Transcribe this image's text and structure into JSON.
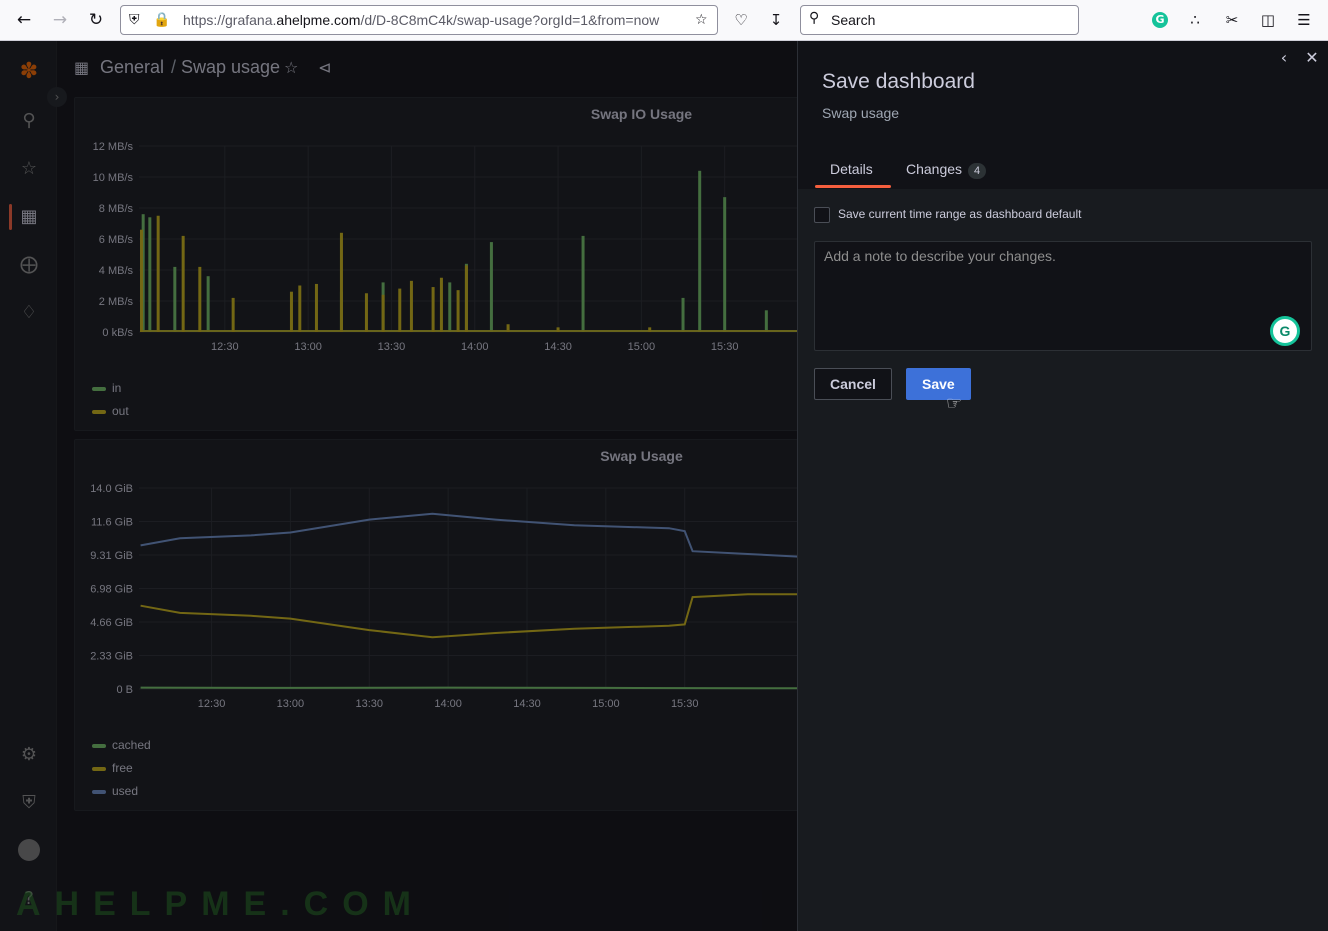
{
  "browser": {
    "url_prefix": "https://grafana.",
    "url_domain": "ahelpme.com",
    "url_rest": "/d/D-8C8mC4k/swap-usage?orgId=1&from=now",
    "search_placeholder": "Search"
  },
  "breadcrumb": {
    "folder": "General",
    "separator": "/",
    "dashboard": "Swap usage"
  },
  "panels": {
    "io": {
      "title": "Swap IO Usage",
      "legend": [
        {
          "name": "in",
          "color": "#73bf69"
        },
        {
          "name": "out",
          "color": "#c8b21b"
        }
      ]
    },
    "usage": {
      "title": "Swap Usage",
      "legend": [
        {
          "name": "cached",
          "color": "#73bf69"
        },
        {
          "name": "free",
          "color": "#c8b21b"
        },
        {
          "name": "used",
          "color": "#6e8ec8"
        }
      ]
    }
  },
  "chart_data": [
    {
      "type": "bar",
      "title": "Swap IO Usage",
      "y_ticks": [
        "0 kB/s",
        "2 MB/s",
        "4 MB/s",
        "6 MB/s",
        "8 MB/s",
        "10 MB/s",
        "12 MB/s"
      ],
      "ylim_mbps": [
        0,
        12
      ],
      "x_ticks": [
        "12:30",
        "13:00",
        "13:30",
        "14:00",
        "14:30",
        "15:00",
        "15:30"
      ],
      "series": [
        {
          "name": "in",
          "color": "#73bf69",
          "peaks": [
            [
              12.01,
              7.6
            ],
            [
              12.05,
              7.4
            ],
            [
              12.2,
              4.2
            ],
            [
              12.4,
              3.6
            ],
            [
              13.2,
              2.6
            ],
            [
              13.45,
              3.2
            ],
            [
              13.85,
              3.2
            ],
            [
              13.95,
              4.4
            ],
            [
              14.1,
              5.8
            ],
            [
              14.65,
              6.2
            ],
            [
              15.25,
              2.2
            ],
            [
              15.35,
              10.4
            ],
            [
              15.5,
              8.7
            ],
            [
              15.75,
              1.4
            ],
            [
              15.95,
              0.4
            ]
          ]
        },
        {
          "name": "out",
          "color": "#c8b21b",
          "peaks": [
            [
              12.0,
              6.6
            ],
            [
              12.1,
              7.5
            ],
            [
              12.25,
              6.2
            ],
            [
              12.35,
              4.2
            ],
            [
              12.55,
              2.2
            ],
            [
              12.9,
              2.6
            ],
            [
              12.95,
              3.0
            ],
            [
              13.05,
              3.1
            ],
            [
              13.2,
              6.4
            ],
            [
              13.35,
              2.5
            ],
            [
              13.45,
              2.4
            ],
            [
              13.55,
              2.8
            ],
            [
              13.62,
              3.3
            ],
            [
              13.75,
              2.9
            ],
            [
              13.8,
              3.5
            ],
            [
              13.9,
              2.7
            ],
            [
              13.95,
              4.3
            ],
            [
              14.2,
              0.5
            ],
            [
              14.5,
              0.3
            ],
            [
              15.05,
              0.3
            ]
          ]
        }
      ]
    },
    {
      "type": "line",
      "title": "Swap Usage",
      "y_ticks": [
        "0 B",
        "2.33 GiB",
        "4.66 GiB",
        "6.98 GiB",
        "9.31 GiB",
        "11.6 GiB",
        "14.0 GiB"
      ],
      "ylim_gib": [
        0,
        14
      ],
      "x_ticks": [
        "12:30",
        "13:00",
        "13:30",
        "14:00",
        "14:30",
        "15:00",
        "15:30"
      ],
      "series": [
        {
          "name": "used",
          "color": "#6e8ec8",
          "points": [
            [
              12.05,
              10.0
            ],
            [
              12.3,
              10.5
            ],
            [
              12.75,
              10.7
            ],
            [
              13.0,
              10.9
            ],
            [
              13.5,
              11.8
            ],
            [
              13.9,
              12.2
            ],
            [
              14.3,
              11.8
            ],
            [
              14.8,
              11.4
            ],
            [
              15.4,
              11.2
            ],
            [
              15.5,
              11.0
            ],
            [
              15.55,
              9.6
            ],
            [
              15.9,
              9.4
            ],
            [
              16.25,
              9.2
            ]
          ]
        },
        {
          "name": "free",
          "color": "#c8b21b",
          "points": [
            [
              12.05,
              5.8
            ],
            [
              12.3,
              5.3
            ],
            [
              12.75,
              5.1
            ],
            [
              13.0,
              4.9
            ],
            [
              13.5,
              4.1
            ],
            [
              13.9,
              3.6
            ],
            [
              14.3,
              3.9
            ],
            [
              14.8,
              4.2
            ],
            [
              15.4,
              4.4
            ],
            [
              15.5,
              4.5
            ],
            [
              15.55,
              6.4
            ],
            [
              15.9,
              6.6
            ],
            [
              16.25,
              6.6
            ]
          ]
        },
        {
          "name": "cached",
          "color": "#73bf69",
          "points": [
            [
              12.05,
              0.1
            ],
            [
              13.0,
              0.08
            ],
            [
              14.0,
              0.1
            ],
            [
              15.0,
              0.08
            ],
            [
              16.25,
              0.05
            ]
          ]
        }
      ]
    }
  ],
  "drawer": {
    "title": "Save dashboard",
    "subtitle": "Swap usage",
    "tab_details": "Details",
    "tab_changes": "Changes",
    "changes_count": "4",
    "checkbox_label": "Save current time range as dashboard default",
    "note_placeholder": "Add a note to describe your changes.",
    "cancel_label": "Cancel",
    "save_label": "Save"
  },
  "watermark": "AHELPME.COM"
}
